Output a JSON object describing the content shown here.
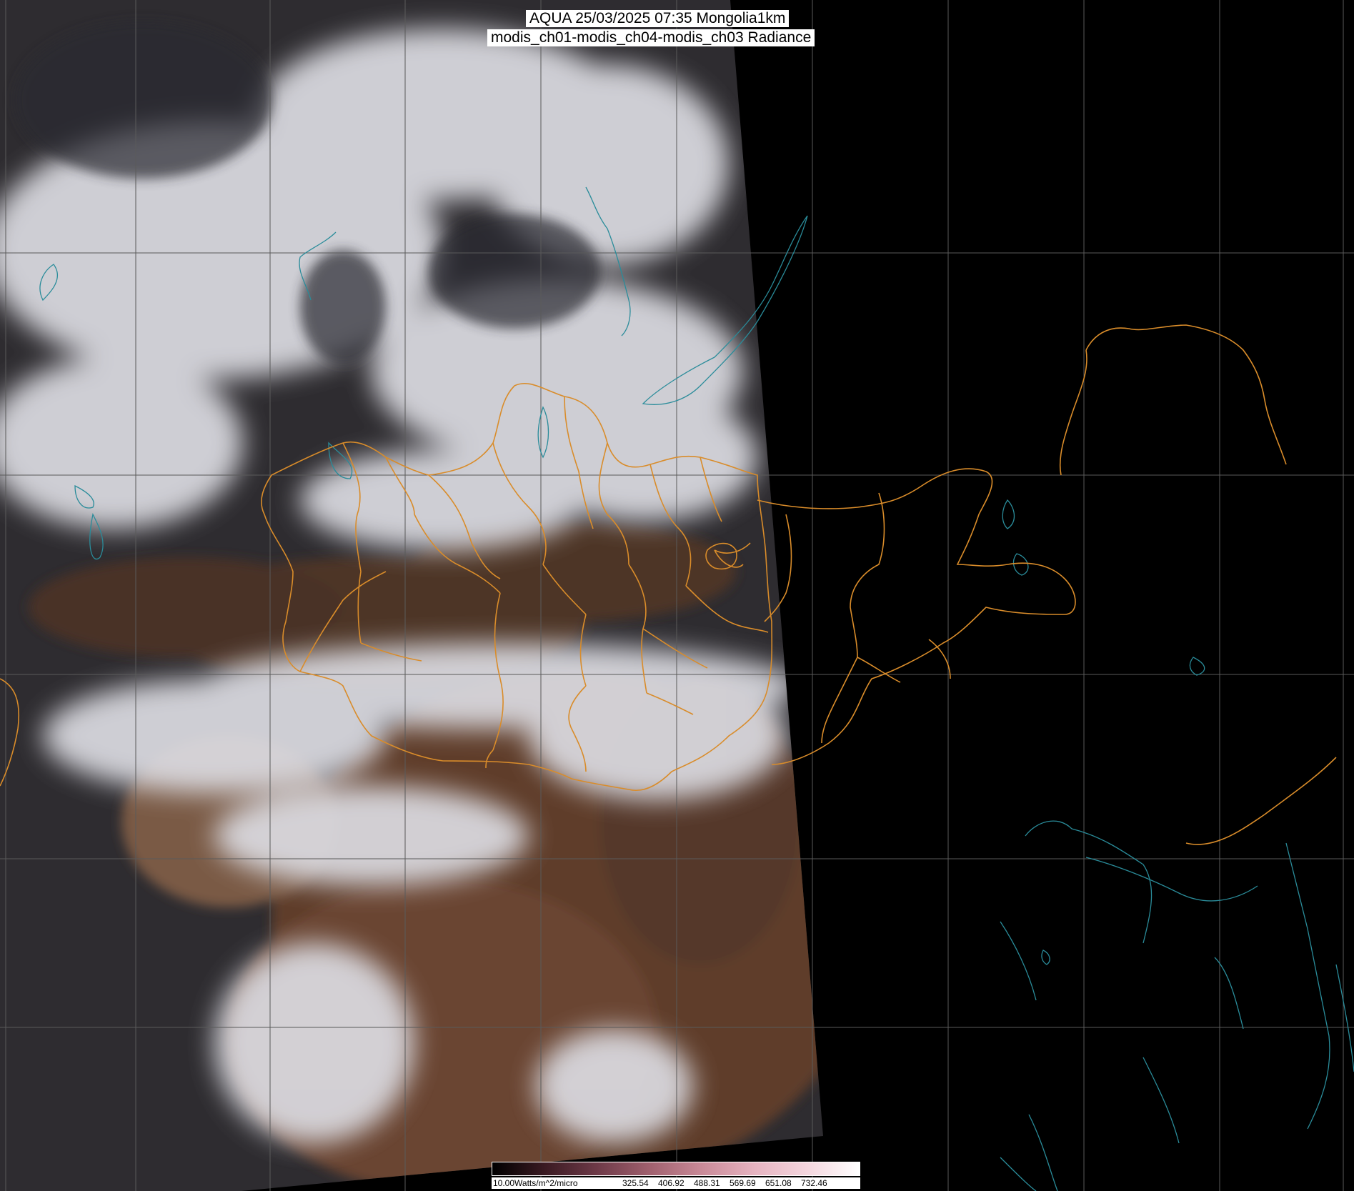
{
  "title": {
    "line1": "AQUA 25/03/2025 07:35 Mongolia1km",
    "line2": "modis_ch01-modis_ch04-modis_ch03 Radiance"
  },
  "colorbar": {
    "unit_label": "10.00Watts/m^2/micro",
    "ticks": [
      "325.54",
      "406.92",
      "488.31",
      "569.69",
      "651.08",
      "732.46"
    ],
    "colors": [
      "#000000",
      "#3a1a22",
      "#6e3a48",
      "#a0606e",
      "#c98a98",
      "#e6b3c0",
      "#f4d6de",
      "#ffffff"
    ]
  },
  "colors": {
    "background": "#000000",
    "grid": "#5a5a5a",
    "border": "#d98c2a",
    "coast_lakes": "#2a8c9a",
    "cloud": "#e8e8ec",
    "land_brown": "#5a3a2a",
    "land_dark": "#2a2628"
  }
}
